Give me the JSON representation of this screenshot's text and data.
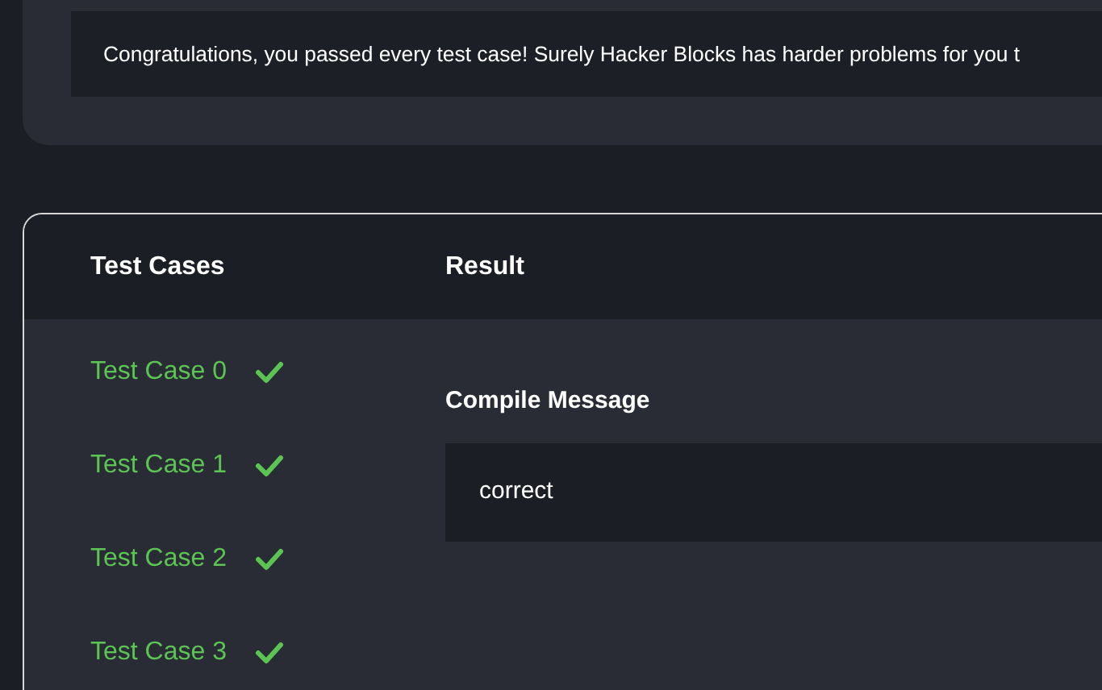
{
  "banner": {
    "message": "Congratulations, you passed every test case! Surely Hacker Blocks has harder problems for you t"
  },
  "results": {
    "sidebar_heading": "Test Cases",
    "main_heading": "Result",
    "test_cases": [
      {
        "label": "Test Case 0",
        "passed": true
      },
      {
        "label": "Test Case 1",
        "passed": true
      },
      {
        "label": "Test Case 2",
        "passed": true
      },
      {
        "label": "Test Case 3",
        "passed": true
      }
    ],
    "compile_message": {
      "label": "Compile Message",
      "value": "correct"
    }
  }
}
